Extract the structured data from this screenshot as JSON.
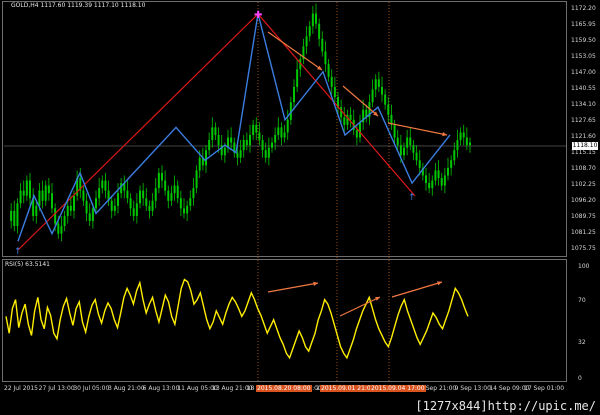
{
  "header": {
    "chart_info": "GOLD,H4 1117.60 1119.39 1117.10 1118.10",
    "rsi_label": "RSI(5) 63.5141"
  },
  "price_axis": {
    "labels": [
      "1172.20",
      "1165.95",
      "1159.50",
      "1153.05",
      "1147.00",
      "1140.55",
      "1134.10",
      "1127.65",
      "1121.60",
      "1115.15",
      "1108.70",
      "1102.25",
      "1096.20",
      "1089.75",
      "1081.25",
      "1075.75"
    ],
    "current_price": "1118.10"
  },
  "rsi_axis": {
    "labels": [
      "100",
      "70",
      "32",
      "0"
    ]
  },
  "time_axis": {
    "labels": [
      "22 Jul 2015",
      "27 Jul 13:00",
      "30 Jul 05:00",
      "3 Aug 21:00",
      "6 Aug 13:00",
      "11 Aug 05:00",
      "13 Aug 21:00",
      "18 Aug 13:00",
      "21 Aug 05:00",
      "25 Aug 21:00",
      "28 Aug 13:00",
      "2 Sep 05:00",
      "4 Sep 21:00",
      "9 Sep 13:00",
      "14 Sep 09:00",
      "17 Sep 01:00"
    ],
    "highlighted": [
      "2015.08.20 08:00",
      "2015.09.01 21:00",
      "2015.09.04 17:00"
    ]
  },
  "watermark": "[1277x844]http://upic.me/",
  "colors": {
    "background": "#000000",
    "candles": "#00c800",
    "zigzag_blue": "#3b7de0",
    "trend_red": "#e01818",
    "arrow_orange": "#f07840",
    "rsi_line": "#ffee00",
    "vline": "#c86414"
  },
  "chart_data": {
    "type": "line",
    "title": "GOLD,H4",
    "price_series": [
      1088,
      1092,
      1086,
      1095,
      1100,
      1098,
      1104,
      1097,
      1090,
      1094,
      1100,
      1096,
      1102,
      1099,
      1093,
      1087,
      1083,
      1086,
      1090,
      1094,
      1092,
      1098,
      1105,
      1100,
      1096,
      1091,
      1088,
      1093,
      1097,
      1101,
      1104,
      1100,
      1096,
      1092,
      1094,
      1099,
      1103,
      1100,
      1097,
      1093,
      1090,
      1095,
      1100,
      1097,
      1094,
      1092,
      1096,
      1101,
      1107,
      1104,
      1100,
      1096,
      1099,
      1102,
      1097,
      1093,
      1091,
      1094,
      1097,
      1101,
      1108,
      1113,
      1110,
      1116,
      1120,
      1125,
      1122,
      1118,
      1114,
      1117,
      1121,
      1119,
      1115,
      1113,
      1116,
      1120,
      1118,
      1122,
      1126,
      1123,
      1120,
      1116,
      1113,
      1117,
      1119,
      1122,
      1125,
      1121,
      1123,
      1128,
      1135,
      1141,
      1148,
      1152,
      1157,
      1161,
      1165,
      1170,
      1166,
      1160,
      1155,
      1150,
      1145,
      1141,
      1137,
      1133,
      1129,
      1126,
      1130,
      1128,
      1124,
      1121,
      1127,
      1132,
      1129,
      1135,
      1140,
      1144,
      1141,
      1138,
      1134,
      1130,
      1126,
      1121,
      1118,
      1114,
      1117,
      1121,
      1118,
      1115,
      1112,
      1109,
      1106,
      1103,
      1101,
      1104,
      1108,
      1105,
      1102,
      1106,
      1109,
      1112,
      1116,
      1120,
      1123,
      1121,
      1118,
      1119
    ],
    "rsi_series": [
      55,
      40,
      62,
      70,
      45,
      58,
      66,
      48,
      38,
      60,
      72,
      52,
      44,
      63,
      56,
      40,
      35,
      52,
      64,
      71,
      58,
      47,
      62,
      68,
      50,
      41,
      55,
      65,
      70,
      57,
      49,
      60,
      67,
      62,
      52,
      45,
      58,
      72,
      80,
      74,
      66,
      78,
      85,
      70,
      58,
      66,
      72,
      60,
      50,
      62,
      74,
      68,
      55,
      48,
      64,
      80,
      88,
      86,
      78,
      66,
      70,
      76,
      64,
      52,
      44,
      50,
      60,
      54,
      48,
      58,
      66,
      72,
      68,
      62,
      55,
      60,
      68,
      76,
      70,
      62,
      56,
      48,
      40,
      46,
      52,
      44,
      36,
      30,
      22,
      18,
      26,
      34,
      42,
      36,
      28,
      24,
      32,
      40,
      52,
      60,
      70,
      66,
      58,
      48,
      38,
      28,
      22,
      18,
      26,
      34,
      44,
      52,
      60,
      66,
      72,
      62,
      52,
      44,
      38,
      32,
      28,
      36,
      46,
      56,
      64,
      70,
      60,
      52,
      44,
      36,
      30,
      36,
      42,
      50,
      58,
      54,
      48,
      44,
      52,
      60,
      70,
      80,
      76,
      70,
      62,
      55
    ],
    "zigzag_series": [
      1080,
      1098,
      1083,
      1107,
      1091,
      1125,
      1112,
      1118,
      1115,
      1170,
      1128,
      1147,
      1122,
      1133,
      1103,
      1122
    ],
    "rsi_range": [
      0,
      100
    ],
    "price_range": [
      1075.75,
      1172.2
    ]
  }
}
